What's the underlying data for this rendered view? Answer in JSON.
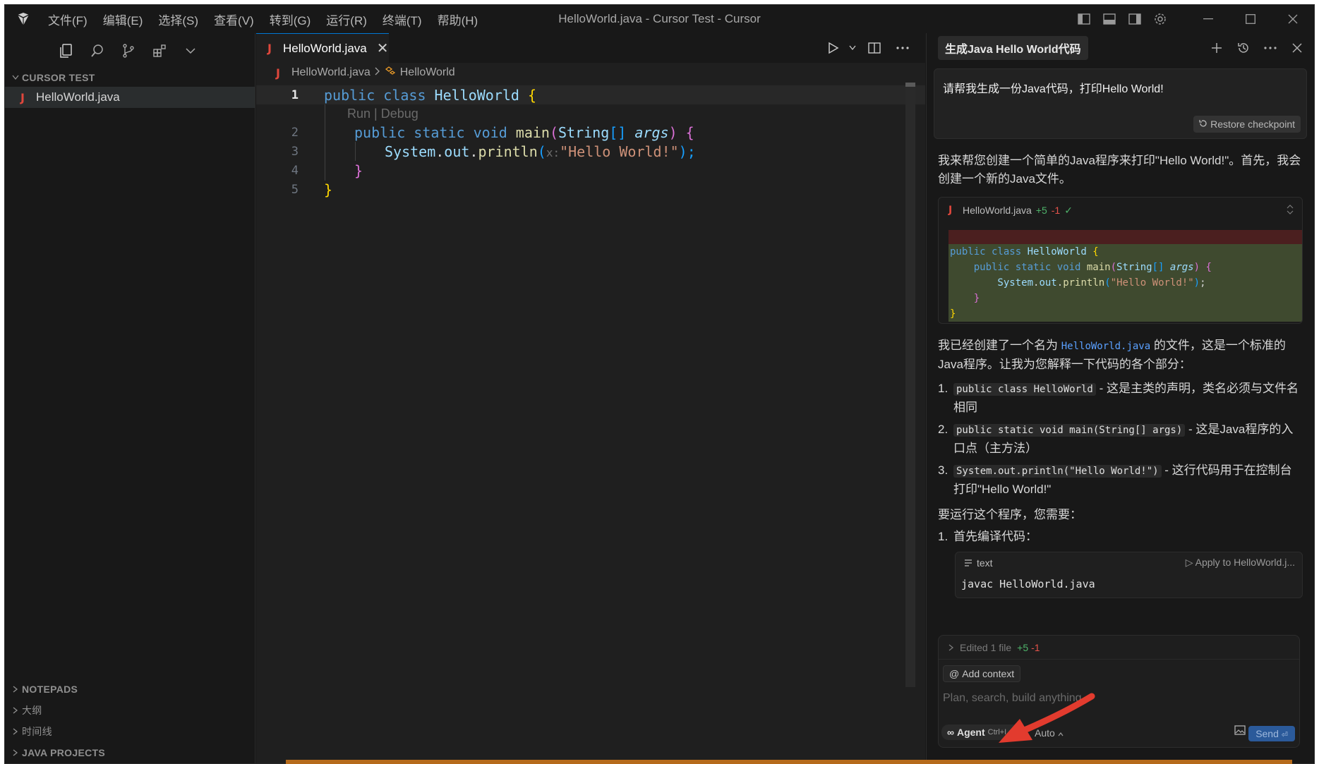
{
  "window": {
    "title": "HelloWorld.java - Cursor Test - Cursor",
    "menu": [
      "文件(F)",
      "编辑(E)",
      "选择(S)",
      "查看(V)",
      "转到(G)",
      "运行(R)",
      "终端(T)",
      "帮助(H)"
    ]
  },
  "sidebar": {
    "project": "CURSOR TEST",
    "files": [
      "HelloWorld.java"
    ],
    "bottom_sections": [
      "NOTEPADS",
      "大纲",
      "时间线",
      "JAVA PROJECTS"
    ]
  },
  "editor": {
    "tab_label": "HelloWorld.java",
    "breadcrumb_file": "HelloWorld.java",
    "breadcrumb_symbol": "HelloWorld",
    "codelens": "Run | Debug",
    "line_numbers": [
      "1",
      "2",
      "3",
      "4",
      "5"
    ],
    "code": {
      "l1_kw": "public class ",
      "l1_cls": "HelloWorld",
      "l1_brace": " {",
      "l2_kw": "public static void ",
      "l2_fn": "main",
      "l2_open": "(",
      "l2_type": "String",
      "l2_arr": "[]",
      "l2_param": " args",
      "l2_close": ") {",
      "l3_obj": "System",
      "l3_dot1": ".",
      "l3_out": "out",
      "l3_dot2": ".",
      "l3_fn": "println",
      "l3_open": "(",
      "l3_hint": "x:",
      "l3_str": "\"Hello World!\"",
      "l3_close": ");",
      "l4": "}",
      "l5": "}"
    }
  },
  "chat": {
    "title": "生成Java Hello World代码",
    "user_message": "请帮我生成一份Java代码，打印Hello World!",
    "restore_label": "Restore checkpoint",
    "para1": "我来帮您创建一个简单的Java程序来打印\"Hello World!\"。首先，我会创建一个新的Java文件。",
    "diff": {
      "file": "HelloWorld.java",
      "added": "+5",
      "removed": "-1",
      "lines": [
        "public class HelloWorld {",
        "    public static void main(String[] args) {",
        "        System.out.println(\"Hello World!\");",
        "    }",
        "}"
      ]
    },
    "para2_pre": "我已经创建了一个名为 ",
    "para2_code": "HelloWorld.java",
    "para2_post": " 的文件，这是一个标准的Java程序。让我为您解释一下代码的各个部分：",
    "explain": [
      {
        "num": "1.",
        "code": "public class HelloWorld",
        "text": " - 这是主类的声明，类名必须与文件名相同"
      },
      {
        "num": "2.",
        "code": "public static void main(String[] args)",
        "text": " - 这是Java程序的入口点（主方法）"
      },
      {
        "num": "3.",
        "code": "System.out.println(\"Hello World!\")",
        "text": " - 这行代码用于在控制台打印\"Hello World!\""
      }
    ],
    "run_intro": "要运行这个程序，您需要：",
    "step1": {
      "num": "1.",
      "text": "首先编译代码："
    },
    "cmd": {
      "lang": "text",
      "apply": "Apply to HelloWorld.j...",
      "code": "javac HelloWorld.java"
    },
    "composer": {
      "edited": "Edited 1 file",
      "edited_add": "+5",
      "edited_del": "-1",
      "add_context": "Add context",
      "placeholder": "Plan, search, build anything",
      "agent": "Agent",
      "agent_shortcut": "Ctrl+I",
      "model": "Auto",
      "send": "Send"
    }
  },
  "colors": {
    "accent": "#0078d4",
    "java_icon": "#e0473c",
    "annotation_arrow": "#e23b2e"
  }
}
